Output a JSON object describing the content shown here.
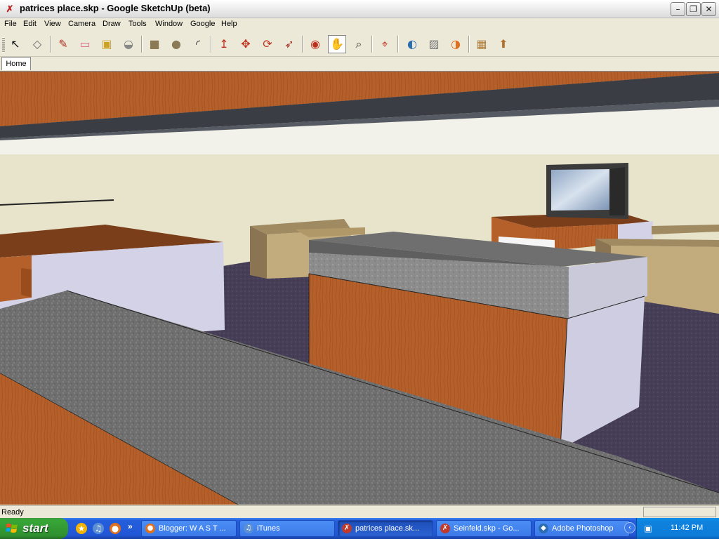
{
  "window": {
    "title": "patrices place.skp - Google SketchUp (beta)",
    "minimize_glyph": "–",
    "maximize_glyph": "❐",
    "close_glyph": "✕"
  },
  "menubar": {
    "items": [
      "File",
      "Edit",
      "View",
      "Camera",
      "Draw",
      "Tools",
      "Window",
      "Google",
      "Help"
    ]
  },
  "toolbar": {
    "active_tool": "pan-icon",
    "tools": [
      {
        "name": "select-icon",
        "glyph": "↖"
      },
      {
        "name": "make-component-icon",
        "glyph": "◇"
      },
      {
        "name": "pencil-icon",
        "glyph": "✎"
      },
      {
        "name": "eraser-icon",
        "glyph": "▭"
      },
      {
        "name": "tape-measure-icon",
        "glyph": "▣"
      },
      {
        "name": "paint-bucket-icon",
        "glyph": "◒"
      },
      {
        "name": "rectangle-icon",
        "glyph": "■"
      },
      {
        "name": "circle-icon",
        "glyph": "●"
      },
      {
        "name": "arc-icon",
        "glyph": "◜"
      },
      {
        "name": "push-pull-icon",
        "glyph": "↥"
      },
      {
        "name": "move-icon",
        "glyph": "✥"
      },
      {
        "name": "rotate-icon",
        "glyph": "⟳"
      },
      {
        "name": "offset-icon",
        "glyph": "➶"
      },
      {
        "name": "orbit-icon",
        "glyph": "◉"
      },
      {
        "name": "pan-icon",
        "glyph": "✋"
      },
      {
        "name": "zoom-icon",
        "glyph": "⌕"
      },
      {
        "name": "zoom-extents-icon",
        "glyph": "⌖"
      },
      {
        "name": "google-earth-icon",
        "glyph": "◐"
      },
      {
        "name": "get-current-view-icon",
        "glyph": "▨"
      },
      {
        "name": "toggle-terrain-icon",
        "glyph": "◑"
      },
      {
        "name": "get-models-icon",
        "glyph": "▦"
      },
      {
        "name": "share-model-icon",
        "glyph": "⬆"
      }
    ]
  },
  "scenes": {
    "tabs": [
      "Home"
    ]
  },
  "status": {
    "text": "Ready",
    "measurements": ""
  },
  "taskbar": {
    "start_label": "start",
    "quick_launch": [
      {
        "name": "aim-icon",
        "glyph": "★",
        "color": "#f2b200"
      },
      {
        "name": "itunes-icon",
        "glyph": "♫",
        "color": "#5a8fd6"
      },
      {
        "name": "firefox-icon",
        "glyph": "●",
        "color": "#e0701c"
      }
    ],
    "more_glyph": "»",
    "tasks": [
      {
        "label": "Blogger: W A S T ...",
        "icon": "firefox-icon",
        "glyph": "●",
        "color": "#e0701c",
        "active": false
      },
      {
        "label": "iTunes",
        "icon": "itunes-icon",
        "glyph": "♫",
        "color": "#5a8fd6",
        "active": false
      },
      {
        "label": "patrices place.sk...",
        "icon": "sketchup-icon",
        "glyph": "✗",
        "color": "#c0392b",
        "active": true
      },
      {
        "label": "Seinfeld.skp - Go...",
        "icon": "sketchup-icon",
        "glyph": "✗",
        "color": "#c0392b",
        "active": false
      },
      {
        "label": "Adobe Photoshop",
        "icon": "photoshop-icon",
        "glyph": "◆",
        "color": "#2b6cb3",
        "active": false
      }
    ],
    "tray_arrow_glyph": "‹",
    "tray_icon_glyph": "▣",
    "clock": "11:42 PM"
  },
  "colors": {
    "wood": "#b8622a",
    "granite": "#8a8a8a",
    "wall": "#e8e4cc",
    "carpet": "#4a4258",
    "xp_blue": "#245edb",
    "start_green": "#37a537"
  }
}
